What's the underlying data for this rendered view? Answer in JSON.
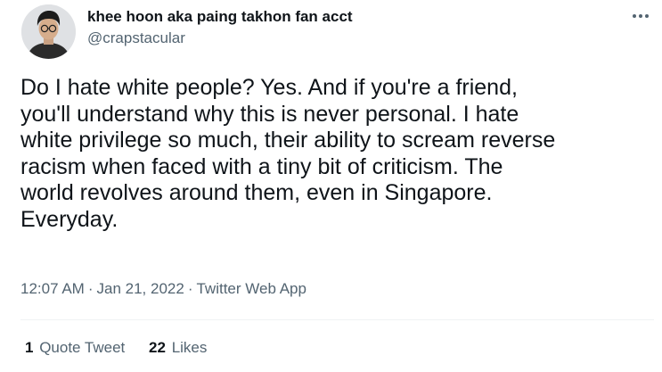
{
  "author": {
    "display_name": "khee hoon aka paing takhon fan acct",
    "handle": "@crapstacular"
  },
  "tweet": {
    "lines": [
      "Do I hate white people? Yes. And if you're a friend,",
      "you'll understand why this is never personal. I hate",
      "white privilege so much, their ability to scream reverse",
      "racism when faced with a tiny bit of criticism. The",
      "world revolves around them, even in Singapore.",
      "Everyday."
    ]
  },
  "meta": {
    "time": "12:07 AM",
    "date": "Jan 21, 2022",
    "separator": "·",
    "source": "Twitter Web App"
  },
  "stats": {
    "quote_tweets": {
      "count": "1",
      "label": "Quote Tweet"
    },
    "likes": {
      "count": "22",
      "label": "Likes"
    }
  },
  "icons": {
    "more": "more-horizontal-icon",
    "avatar": "avatar-image"
  },
  "colors": {
    "text_primary": "#0f1419",
    "text_secondary": "#536471",
    "divider": "#eff3f4"
  }
}
